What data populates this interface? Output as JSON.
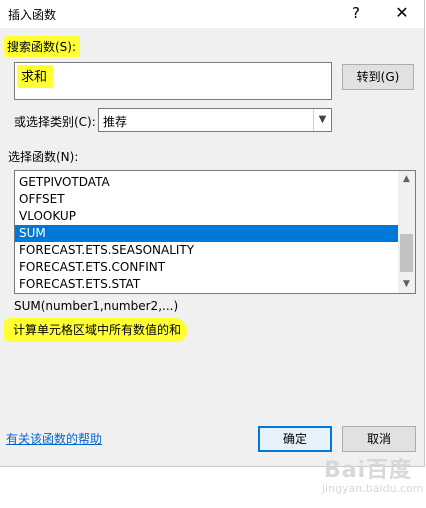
{
  "window": {
    "title": "插入函数",
    "help_glyph": "?",
    "close_glyph": "✕"
  },
  "search": {
    "label": "搜索函数(S):",
    "value": "求和",
    "goto_label": "转到(G)"
  },
  "category": {
    "label": "或选择类别(C):",
    "selected": "推荐"
  },
  "functions": {
    "label": "选择函数(N):",
    "items": [
      {
        "name": "GETPIVOTDATA",
        "selected": false
      },
      {
        "name": "OFFSET",
        "selected": false
      },
      {
        "name": "VLOOKUP",
        "selected": false
      },
      {
        "name": "SUM",
        "selected": true
      },
      {
        "name": "FORECAST.ETS.SEASONALITY",
        "selected": false
      },
      {
        "name": "FORECAST.ETS.CONFINT",
        "selected": false
      },
      {
        "name": "FORECAST.ETS.STAT",
        "selected": false
      }
    ]
  },
  "details": {
    "syntax": "SUM(number1,number2,...)",
    "description": "计算单元格区域中所有数值的和"
  },
  "footer": {
    "help_link": "有关该函数的帮助",
    "ok_label": "确定",
    "cancel_label": "取消"
  },
  "watermark": {
    "logo": "Bai百度",
    "sub": "jingyan.baidu.com"
  },
  "colors": {
    "highlight": "#ffff33",
    "selection": "#0078d7",
    "link": "#0066cc"
  }
}
